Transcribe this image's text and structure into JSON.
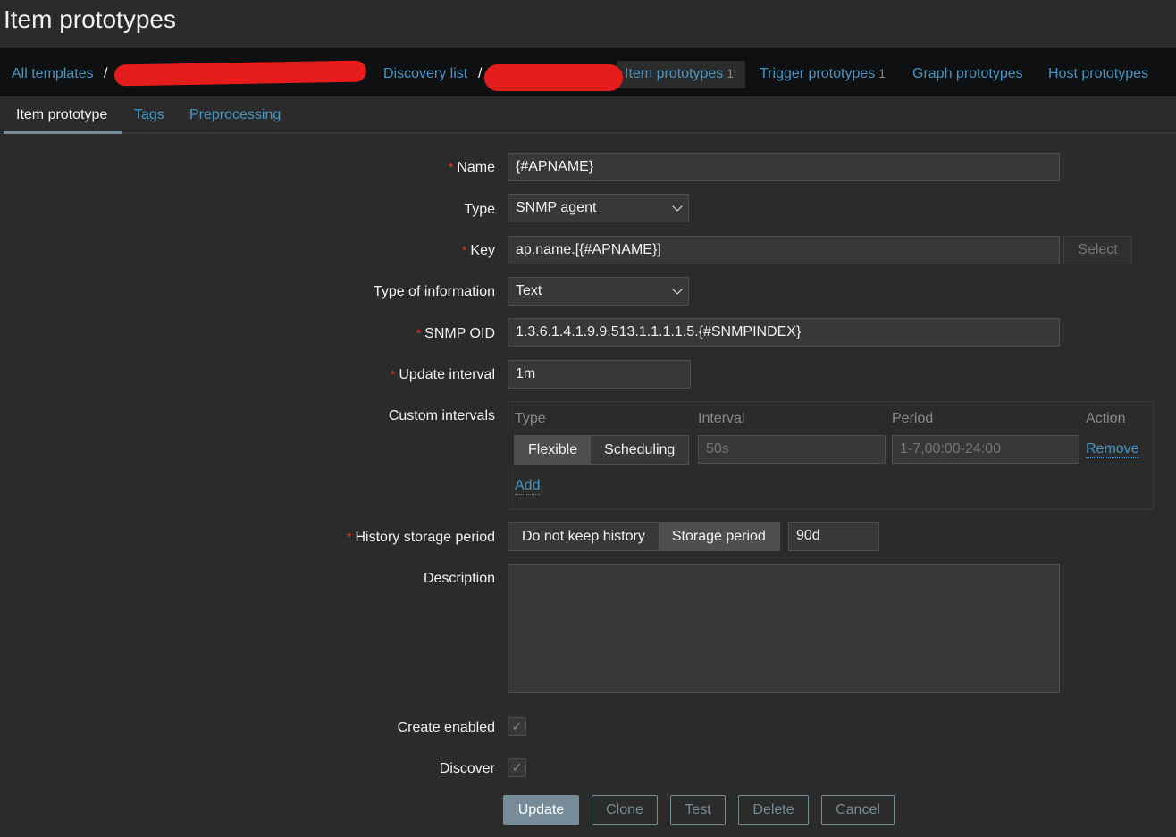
{
  "page_title": "Item prototypes",
  "breadcrumb": {
    "all_templates": "All templates",
    "discovery_list": "Discovery list",
    "separator": "/",
    "tabs": [
      {
        "label": "Item prototypes",
        "count": "1"
      },
      {
        "label": "Trigger prototypes",
        "count": "1"
      },
      {
        "label": "Graph prototypes"
      },
      {
        "label": "Host prototypes"
      }
    ]
  },
  "form_tabs": [
    "Item prototype",
    "Tags",
    "Preprocessing"
  ],
  "fields": {
    "name": {
      "label": "Name",
      "value": "{#APNAME}"
    },
    "type": {
      "label": "Type",
      "value": "SNMP agent"
    },
    "key": {
      "label": "Key",
      "value": "ap.name.[{#APNAME}]",
      "select": "Select"
    },
    "type_of_info": {
      "label": "Type of information",
      "value": "Text"
    },
    "snmp_oid": {
      "label": "SNMP OID",
      "value": "1.3.6.1.4.1.9.9.513.1.1.1.1.5.{#SNMPINDEX}"
    },
    "update_interval": {
      "label": "Update interval",
      "value": "1m"
    },
    "custom_intervals": {
      "label": "Custom intervals",
      "headers": [
        "Type",
        "Interval",
        "Period",
        "Action"
      ],
      "row": {
        "type_options": [
          "Flexible",
          "Scheduling"
        ],
        "selected": "Flexible",
        "interval_placeholder": "50s",
        "period_placeholder": "1-7,00:00-24:00",
        "action": "Remove"
      },
      "add": "Add"
    },
    "history": {
      "label": "History storage period",
      "options": [
        "Do not keep history",
        "Storage period"
      ],
      "selected": "Storage period",
      "value": "90d"
    },
    "description": {
      "label": "Description",
      "value": ""
    },
    "create_enabled": {
      "label": "Create enabled",
      "checked": true
    },
    "discover": {
      "label": "Discover",
      "checked": true
    }
  },
  "buttons": [
    "Update",
    "Clone",
    "Test",
    "Delete",
    "Cancel"
  ]
}
